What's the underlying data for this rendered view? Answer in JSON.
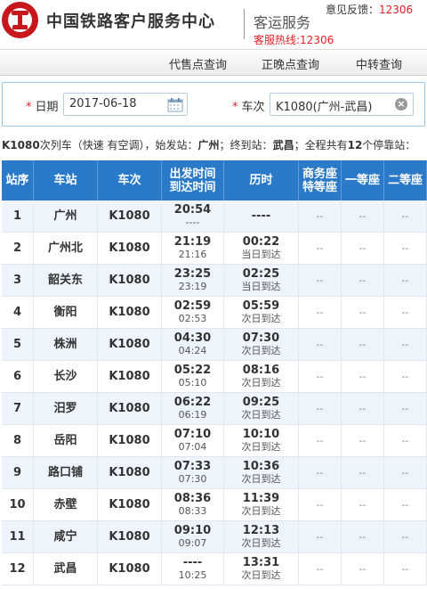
{
  "header": {
    "brand": "中国铁路客户服务中心",
    "service": "客运服务",
    "hotline": "客服热线:12306",
    "feedback_label": "意见反馈：",
    "feedback_num": "12306"
  },
  "nav": {
    "items": [
      "代售点查询",
      "正晚点查询",
      "中转查询"
    ]
  },
  "search": {
    "date_label": "日期",
    "date_value": "2017-06-18",
    "train_label": "车次",
    "train_value": "K1080(广州-武昌)"
  },
  "summary": {
    "train": "K1080",
    "text1": "次列车（快速 有空调），始发站：",
    "from": "广州",
    "text2": "；终到站：",
    "to": "武昌",
    "text3": "；全程共有",
    "count": "12",
    "text4": "个停靠站："
  },
  "table": {
    "headers": [
      "站序",
      "车站",
      "车次",
      "出发时间",
      "到达时间",
      "历时",
      "商务座",
      "特等座",
      "一等座",
      "二等座"
    ],
    "rows": [
      {
        "no": "1",
        "station": "广州",
        "train": "K1080",
        "depart": "20:54",
        "arrive": "----",
        "dur": "----",
        "dur_note": "",
        "s1": "--",
        "s2": "--",
        "s3": "--"
      },
      {
        "no": "2",
        "station": "广州北",
        "train": "K1080",
        "depart": "21:19",
        "arrive": "21:16",
        "dur": "00:22",
        "dur_note": "当日到达",
        "s1": "--",
        "s2": "--",
        "s3": "--"
      },
      {
        "no": "3",
        "station": "韶关东",
        "train": "K1080",
        "depart": "23:25",
        "arrive": "23:19",
        "dur": "02:25",
        "dur_note": "当日到达",
        "s1": "--",
        "s2": "--",
        "s3": "--"
      },
      {
        "no": "4",
        "station": "衡阳",
        "train": "K1080",
        "depart": "02:59",
        "arrive": "02:53",
        "dur": "05:59",
        "dur_note": "次日到达",
        "s1": "--",
        "s2": "--",
        "s3": "--"
      },
      {
        "no": "5",
        "station": "株洲",
        "train": "K1080",
        "depart": "04:30",
        "arrive": "04:24",
        "dur": "07:30",
        "dur_note": "次日到达",
        "s1": "--",
        "s2": "--",
        "s3": "--"
      },
      {
        "no": "6",
        "station": "长沙",
        "train": "K1080",
        "depart": "05:22",
        "arrive": "05:10",
        "dur": "08:16",
        "dur_note": "次日到达",
        "s1": "--",
        "s2": "--",
        "s3": "--"
      },
      {
        "no": "7",
        "station": "汨罗",
        "train": "K1080",
        "depart": "06:22",
        "arrive": "06:19",
        "dur": "09:25",
        "dur_note": "次日到达",
        "s1": "--",
        "s2": "--",
        "s3": "--"
      },
      {
        "no": "8",
        "station": "岳阳",
        "train": "K1080",
        "depart": "07:10",
        "arrive": "07:04",
        "dur": "10:10",
        "dur_note": "次日到达",
        "s1": "--",
        "s2": "--",
        "s3": "--"
      },
      {
        "no": "9",
        "station": "路口铺",
        "train": "K1080",
        "depart": "07:33",
        "arrive": "07:30",
        "dur": "10:36",
        "dur_note": "次日到达",
        "s1": "--",
        "s2": "--",
        "s3": "--"
      },
      {
        "no": "10",
        "station": "赤壁",
        "train": "K1080",
        "depart": "08:36",
        "arrive": "08:33",
        "dur": "11:39",
        "dur_note": "次日到达",
        "s1": "--",
        "s2": "--",
        "s3": "--"
      },
      {
        "no": "11",
        "station": "咸宁",
        "train": "K1080",
        "depart": "09:10",
        "arrive": "09:07",
        "dur": "12:13",
        "dur_note": "次日到达",
        "s1": "--",
        "s2": "--",
        "s3": "--"
      },
      {
        "no": "12",
        "station": "武昌",
        "train": "K1080",
        "depart": "----",
        "arrive": "10:25",
        "dur": "13:31",
        "dur_note": "次日到达",
        "s1": "--",
        "s2": "--",
        "s3": "--"
      }
    ]
  }
}
